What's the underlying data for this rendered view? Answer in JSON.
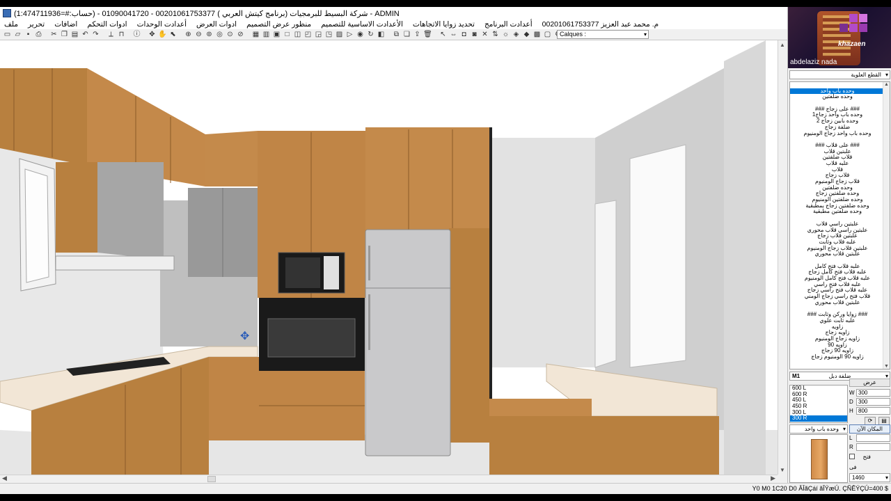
{
  "window": {
    "title": "شركة البسيط للبرمجيات (برنامج كيتش العربي ) 00201061753377 - 01090041720 - (حساب:#=1:474711936) - ADMIN"
  },
  "menus": {
    "right": [
      "ملف",
      "تحرير",
      "اضافات",
      "ادوات التحكم",
      "أعدادت الوحدات",
      "ادوات العرض",
      "منظور عرض التصميم",
      "الأعدادت الاساسية للتصميم",
      "تحديد زوايا الاتجاهات",
      "أعدادت البرنامج"
    ],
    "user": "م. محمد عبد العزيز 00201061753377"
  },
  "toolbar": {
    "layer_label": "Calques :"
  },
  "webcam": {
    "name": "abdelaziz nada",
    "brand": "khazaen"
  },
  "panel": {
    "category_combo": "القطع العلوية",
    "unit_list": [
      {
        "text": "",
        "blank": true
      },
      {
        "text": "وحده باب واحد",
        "selected": true
      },
      {
        "text": "وحده ضلفتين"
      },
      {
        "text": "",
        "blank": true
      },
      {
        "text": "### على زجاج ###"
      },
      {
        "text": "وحده باب واحد زجاج1"
      },
      {
        "text": "وحده بابين زجاج 2"
      },
      {
        "text": "ضلفة زجاج"
      },
      {
        "text": "وحده باب واحد زجاج الومنيوم"
      },
      {
        "text": "",
        "blank": true
      },
      {
        "text": "### على قلاب ###"
      },
      {
        "text": "علبتين قلاب"
      },
      {
        "text": "قلاب ضلفتين"
      },
      {
        "text": "علبه قلاب"
      },
      {
        "text": "قلاب"
      },
      {
        "text": "قلاب زجاج"
      },
      {
        "text": "قلاب زجاج الومنيوم"
      },
      {
        "text": "وحده ضلفتين"
      },
      {
        "text": "وحده ضلفتين زجاج"
      },
      {
        "text": "وحده ضلفتين الومنيوم"
      },
      {
        "text": "وحده ضلفتين زجاج بمطبقية"
      },
      {
        "text": "وحده ضلفتين مطبقية"
      },
      {
        "text": "",
        "blank": true
      },
      {
        "text": "علبتين راسي قلاب"
      },
      {
        "text": "علبتين راسي قلاب محوري"
      },
      {
        "text": "علبتين قلاب زجاج"
      },
      {
        "text": "علبه قلاب وثابت"
      },
      {
        "text": "علبتين قلاب زجاج الومنيوم"
      },
      {
        "text": "علبتين قلاب محوري"
      },
      {
        "text": "",
        "blank": true
      },
      {
        "text": "علبه قلاب فتح كامل"
      },
      {
        "text": "علبه قلاب فتح كامل زجاج"
      },
      {
        "text": "علبه قلاب فتح كامل الومنيوم"
      },
      {
        "text": "علبه قلاب فتح راسي"
      },
      {
        "text": "علبه قلاب فتح راسي زجاج"
      },
      {
        "text": "قلاب فتح راسي زجاج الومني"
      },
      {
        "text": "علبتين قلاب محوري"
      },
      {
        "text": "",
        "blank": true
      },
      {
        "text": "### زوايا وركن وثابت ###"
      },
      {
        "text": "علبه ثابت علوي"
      },
      {
        "text": "زاويه"
      },
      {
        "text": "زاويه زجاج"
      },
      {
        "text": "زاويه زجاج الومنيوم"
      },
      {
        "text": "زاويه 90"
      },
      {
        "text": "زاويه 90 زجاج"
      },
      {
        "text": "زاويه 90 الومنيوم زجاج"
      }
    ],
    "code": "M1",
    "type_combo": "ضلفة دبل",
    "sizes": [
      {
        "text": "600 L"
      },
      {
        "text": "600 R"
      },
      {
        "text": "450 L"
      },
      {
        "text": "450 R"
      },
      {
        "text": "300 L"
      },
      {
        "text": "300 R",
        "selected": true
      }
    ],
    "dims_header": "عرض",
    "dims": [
      {
        "label": "W",
        "value": "300"
      },
      {
        "label": "D",
        "value": "300"
      },
      {
        "label": "H",
        "value": "800"
      }
    ],
    "place_button": "المكان الآن",
    "unit_combo": "وحده باب واحد",
    "fields": [
      {
        "label": "L",
        "value": ""
      },
      {
        "label": "R",
        "value": ""
      }
    ],
    "open_label": "فتح",
    "bottom_label": "فى",
    "bottom_value": "1460"
  },
  "status": {
    "text": "Y0 M0  1C20 D0 ÂÎãÇáí ãÎÝæÚ. ÇÑÊÝÇÚ=400 $"
  },
  "scene_colors": {
    "wood": "#b8803f",
    "wall": "#cfcfcf",
    "counter": "#f2e6d6"
  }
}
